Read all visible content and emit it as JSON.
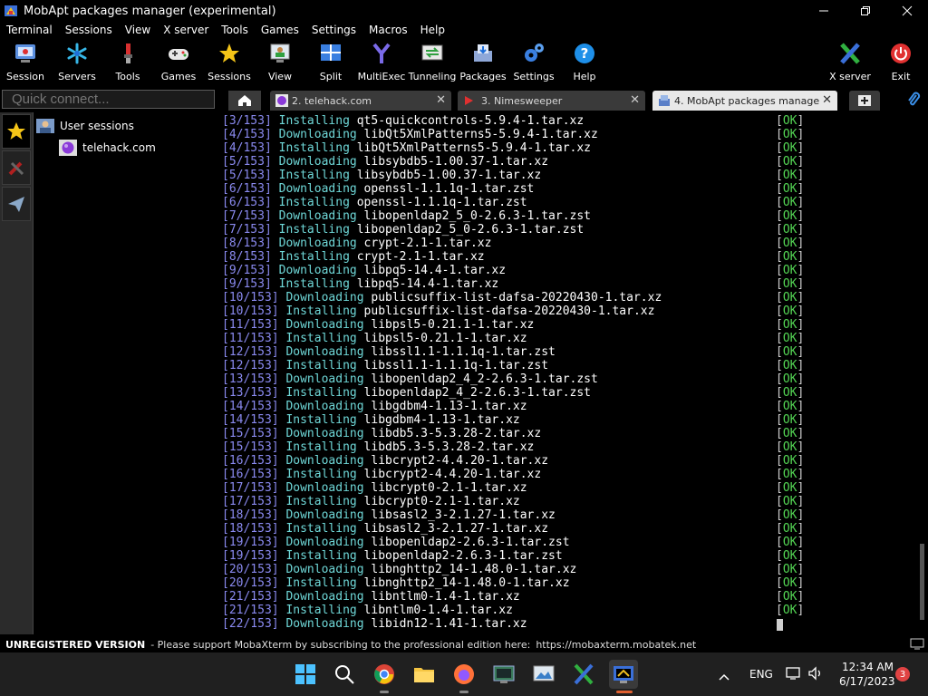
{
  "window": {
    "title": "MobApt packages manager (experimental)"
  },
  "menu": [
    "Terminal",
    "Sessions",
    "View",
    "X server",
    "Tools",
    "Games",
    "Settings",
    "Macros",
    "Help"
  ],
  "toolbar": {
    "session": "Session",
    "servers": "Servers",
    "tools": "Tools",
    "games": "Games",
    "sessions": "Sessions",
    "view": "View",
    "split": "Split",
    "multiexec": "MultiExec",
    "tunneling": "Tunneling",
    "packages": "Packages",
    "settings": "Settings",
    "help": "Help",
    "xserver": "X server",
    "exit": "Exit"
  },
  "quick_connect": {
    "placeholder": "Quick connect..."
  },
  "tabs": [
    {
      "label": "2. telehack.com"
    },
    {
      "label": "3. Nimesweeper"
    },
    {
      "label": "4. MobApt packages manager"
    }
  ],
  "sessions_tree": {
    "root": "User sessions",
    "child": "telehack.com"
  },
  "terminal": {
    "ok_label": "OK",
    "lines": [
      [
        "[3/153]",
        "Installing",
        "qt5-quickcontrols-5.9.4-1.tar.xz"
      ],
      [
        "[4/153]",
        "Downloading",
        "libQt5XmlPatterns5-5.9.4-1.tar.xz"
      ],
      [
        "[4/153]",
        "Installing",
        "libQt5XmlPatterns5-5.9.4-1.tar.xz"
      ],
      [
        "[5/153]",
        "Downloading",
        "libsybdb5-1.00.37-1.tar.xz"
      ],
      [
        "[5/153]",
        "Installing",
        "libsybdb5-1.00.37-1.tar.xz"
      ],
      [
        "[6/153]",
        "Downloading",
        "openssl-1.1.1q-1.tar.zst"
      ],
      [
        "[6/153]",
        "Installing",
        "openssl-1.1.1q-1.tar.zst"
      ],
      [
        "[7/153]",
        "Downloading",
        "libopenldap2_5_0-2.6.3-1.tar.zst"
      ],
      [
        "[7/153]",
        "Installing",
        "libopenldap2_5_0-2.6.3-1.tar.zst"
      ],
      [
        "[8/153]",
        "Downloading",
        "crypt-2.1-1.tar.xz"
      ],
      [
        "[8/153]",
        "Installing",
        "crypt-2.1-1.tar.xz"
      ],
      [
        "[9/153]",
        "Downloading",
        "libpq5-14.4-1.tar.xz"
      ],
      [
        "[9/153]",
        "Installing",
        "libpq5-14.4-1.tar.xz"
      ],
      [
        "[10/153]",
        "Downloading",
        "publicsuffix-list-dafsa-20220430-1.tar.xz"
      ],
      [
        "[10/153]",
        "Installing",
        "publicsuffix-list-dafsa-20220430-1.tar.xz"
      ],
      [
        "[11/153]",
        "Downloading",
        "libpsl5-0.21.1-1.tar.xz"
      ],
      [
        "[11/153]",
        "Installing",
        "libpsl5-0.21.1-1.tar.xz"
      ],
      [
        "[12/153]",
        "Downloading",
        "libssl1.1-1.1.1q-1.tar.zst"
      ],
      [
        "[12/153]",
        "Installing",
        "libssl1.1-1.1.1q-1.tar.zst"
      ],
      [
        "[13/153]",
        "Downloading",
        "libopenldap2_4_2-2.6.3-1.tar.zst"
      ],
      [
        "[13/153]",
        "Installing",
        "libopenldap2_4_2-2.6.3-1.tar.zst"
      ],
      [
        "[14/153]",
        "Downloading",
        "libgdbm4-1.13-1.tar.xz"
      ],
      [
        "[14/153]",
        "Installing",
        "libgdbm4-1.13-1.tar.xz"
      ],
      [
        "[15/153]",
        "Downloading",
        "libdb5.3-5.3.28-2.tar.xz"
      ],
      [
        "[15/153]",
        "Installing",
        "libdb5.3-5.3.28-2.tar.xz"
      ],
      [
        "[16/153]",
        "Downloading",
        "libcrypt2-4.4.20-1.tar.xz"
      ],
      [
        "[16/153]",
        "Installing",
        "libcrypt2-4.4.20-1.tar.xz"
      ],
      [
        "[17/153]",
        "Downloading",
        "libcrypt0-2.1-1.tar.xz"
      ],
      [
        "[17/153]",
        "Installing",
        "libcrypt0-2.1-1.tar.xz"
      ],
      [
        "[18/153]",
        "Downloading",
        "libsasl2_3-2.1.27-1.tar.xz"
      ],
      [
        "[18/153]",
        "Installing",
        "libsasl2_3-2.1.27-1.tar.xz"
      ],
      [
        "[19/153]",
        "Downloading",
        "libopenldap2-2.6.3-1.tar.zst"
      ],
      [
        "[19/153]",
        "Installing",
        "libopenldap2-2.6.3-1.tar.zst"
      ],
      [
        "[20/153]",
        "Downloading",
        "libnghttp2_14-1.48.0-1.tar.xz"
      ],
      [
        "[20/153]",
        "Installing",
        "libnghttp2_14-1.48.0-1.tar.xz"
      ],
      [
        "[21/153]",
        "Downloading",
        "libntlm0-1.4-1.tar.xz"
      ],
      [
        "[21/153]",
        "Installing",
        "libntlm0-1.4-1.tar.xz"
      ],
      [
        "[22/153]",
        "Downloading",
        "libidn12-1.41-1.tar.xz"
      ]
    ]
  },
  "status": {
    "unregistered": "UNREGISTERED VERSION",
    "message": "-  Please support MobaXterm by subscribing to the professional edition here:",
    "link": "https://mobaxterm.mobatek.net"
  },
  "tray": {
    "language": "ENG",
    "time": "12:34 AM",
    "date": "6/17/2023",
    "notifications": "3"
  },
  "colors": {
    "counter": "#8a8af0",
    "action": "#6fd8d8",
    "ok": "#54d654",
    "accent_blue": "#1e6fd9"
  }
}
